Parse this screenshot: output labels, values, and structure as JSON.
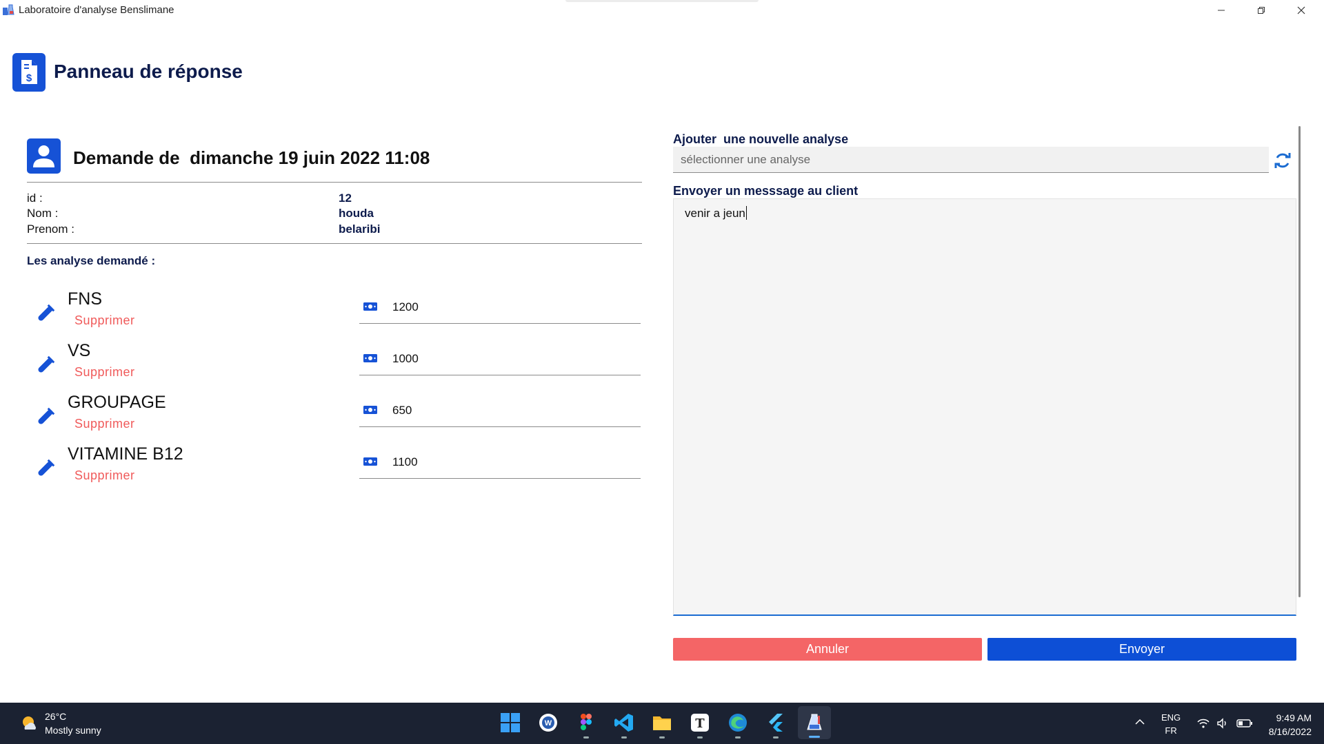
{
  "window": {
    "title": "Laboratoire d'analyse Benslimane"
  },
  "header": {
    "title": "Panneau de réponse"
  },
  "request": {
    "title_prefix": "Demande de ",
    "title_date": "dimanche 19 juin 2022 11:08",
    "fields": [
      {
        "label": "id :",
        "value": "12"
      },
      {
        "label": "Nom :",
        "value": "houda"
      },
      {
        "label": "Prenom :",
        "value": "belaribi"
      }
    ],
    "analyses_label": "Les analyse demandé :",
    "analyses": [
      {
        "name": "FNS",
        "delete_label": "Supprimer",
        "price": "1200"
      },
      {
        "name": "VS",
        "delete_label": "Supprimer",
        "price": "1000"
      },
      {
        "name": "GROUPAGE",
        "delete_label": "Supprimer",
        "price": "650"
      },
      {
        "name": "VITAMINE B12",
        "delete_label": "Supprimer",
        "price": "1100"
      }
    ]
  },
  "right_panel": {
    "add_label": "Ajouter  une nouvelle analyse",
    "select_placeholder": "sélectionner une analyse",
    "message_label": "Envoyer un messsage au client",
    "message_value": "venir a jeun",
    "cancel_label": "Annuler",
    "send_label": "Envoyer"
  },
  "taskbar": {
    "weather_temp": "26°C",
    "weather_desc": "Mostly sunny",
    "lang_top": "ENG",
    "lang_bottom": "FR",
    "time": "9:49 AM",
    "date": "8/16/2022",
    "apps": [
      "windows-start",
      "app-w",
      "figma",
      "vscode",
      "file-explorer",
      "typora",
      "edge",
      "flutter",
      "lab-app"
    ]
  },
  "colors": {
    "primary": "#1652d6",
    "danger": "#f46566",
    "navy": "#0d1b4c",
    "send": "#0d4fd6"
  }
}
